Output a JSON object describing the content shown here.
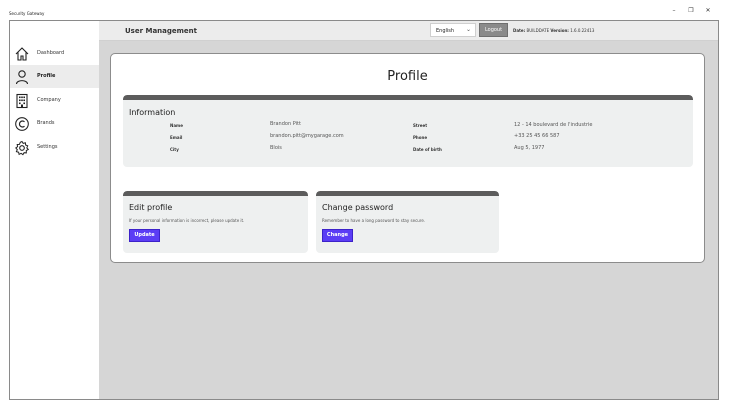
{
  "window": {
    "title": "Security Gateway",
    "controls": {
      "minimize": "–",
      "maximize": "❐",
      "close": "✕"
    }
  },
  "topbar": {
    "page_title": "User Management",
    "language": "English",
    "logout_label": "Logout",
    "date_label": "Date:",
    "date_value": "BUILDDATE",
    "version_label": "Version:",
    "version_value": "1.6.0.22413"
  },
  "sidebar": {
    "items": [
      {
        "label": "Dashboard",
        "icon": "home-icon",
        "active": false
      },
      {
        "label": "Profile",
        "icon": "user-icon",
        "active": true
      },
      {
        "label": "Company",
        "icon": "building-icon",
        "active": false
      },
      {
        "label": "Brands",
        "icon": "copyright-icon",
        "active": false
      },
      {
        "label": "Settings",
        "icon": "gear-icon",
        "active": false
      }
    ]
  },
  "profile": {
    "title": "Profile",
    "information": {
      "title": "Information",
      "name_label": "Name",
      "name": "Brandon Pitt",
      "email_label": "Email",
      "email": "brandon.pitt@mygarage.com",
      "city_label": "City",
      "city": "Blois",
      "street_label": "Street",
      "street": "12 - 14 boulevard de l'industrie",
      "phone_label": "Phone",
      "phone": "+33 25 45 66 587",
      "dob_label": "Date of birth",
      "dob": "Aug 5, 1977"
    },
    "edit": {
      "title": "Edit profile",
      "description": "If your personal information is incorrect, please update it.",
      "button": "Update"
    },
    "password": {
      "title": "Change password",
      "description": "Remember to have a long password to stay secure.",
      "button": "Change"
    }
  },
  "colors": {
    "accent": "#5b3df5",
    "panel_bar": "#5c5c5c",
    "background": "#d6d6d6"
  }
}
